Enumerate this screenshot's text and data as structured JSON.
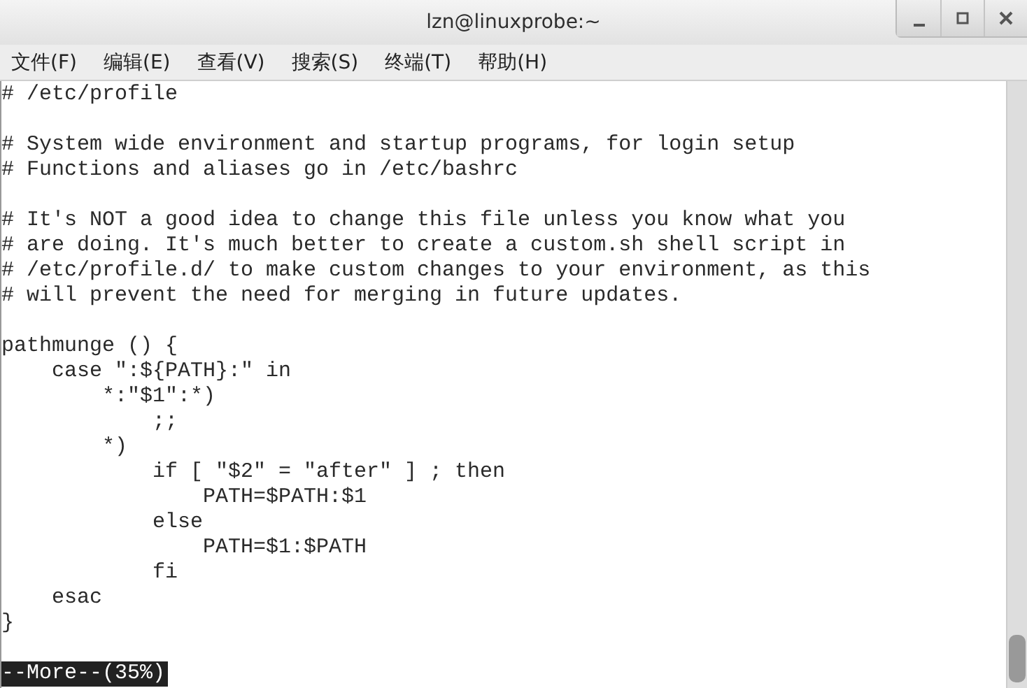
{
  "window": {
    "title": "lzn@linuxprobe:~"
  },
  "menu": [
    "文件(F)",
    "编辑(E)",
    "查看(V)",
    "搜索(S)",
    "终端(T)",
    "帮助(H)"
  ],
  "terminal": {
    "blocks": [
      [
        "# /etc/profile"
      ],
      [
        "# System wide environment and startup programs, for login setup",
        "# Functions and aliases go in /etc/bashrc"
      ],
      [
        "# It's NOT a good idea to change this file unless you know what you",
        "# are doing. It's much better to create a custom.sh shell script in",
        "# /etc/profile.d/ to make custom changes to your environment, as this",
        "# will prevent the need for merging in future updates."
      ],
      [
        "pathmunge () {",
        "    case \":${PATH}:\" in",
        "        *:\"$1\":*)",
        "            ;;",
        "        *)",
        "            if [ \"$2\" = \"after\" ] ; then",
        "                PATH=$PATH:$1",
        "            else",
        "                PATH=$1:$PATH",
        "            fi",
        "    esac",
        "}"
      ]
    ],
    "status": "--More--(35%)"
  }
}
